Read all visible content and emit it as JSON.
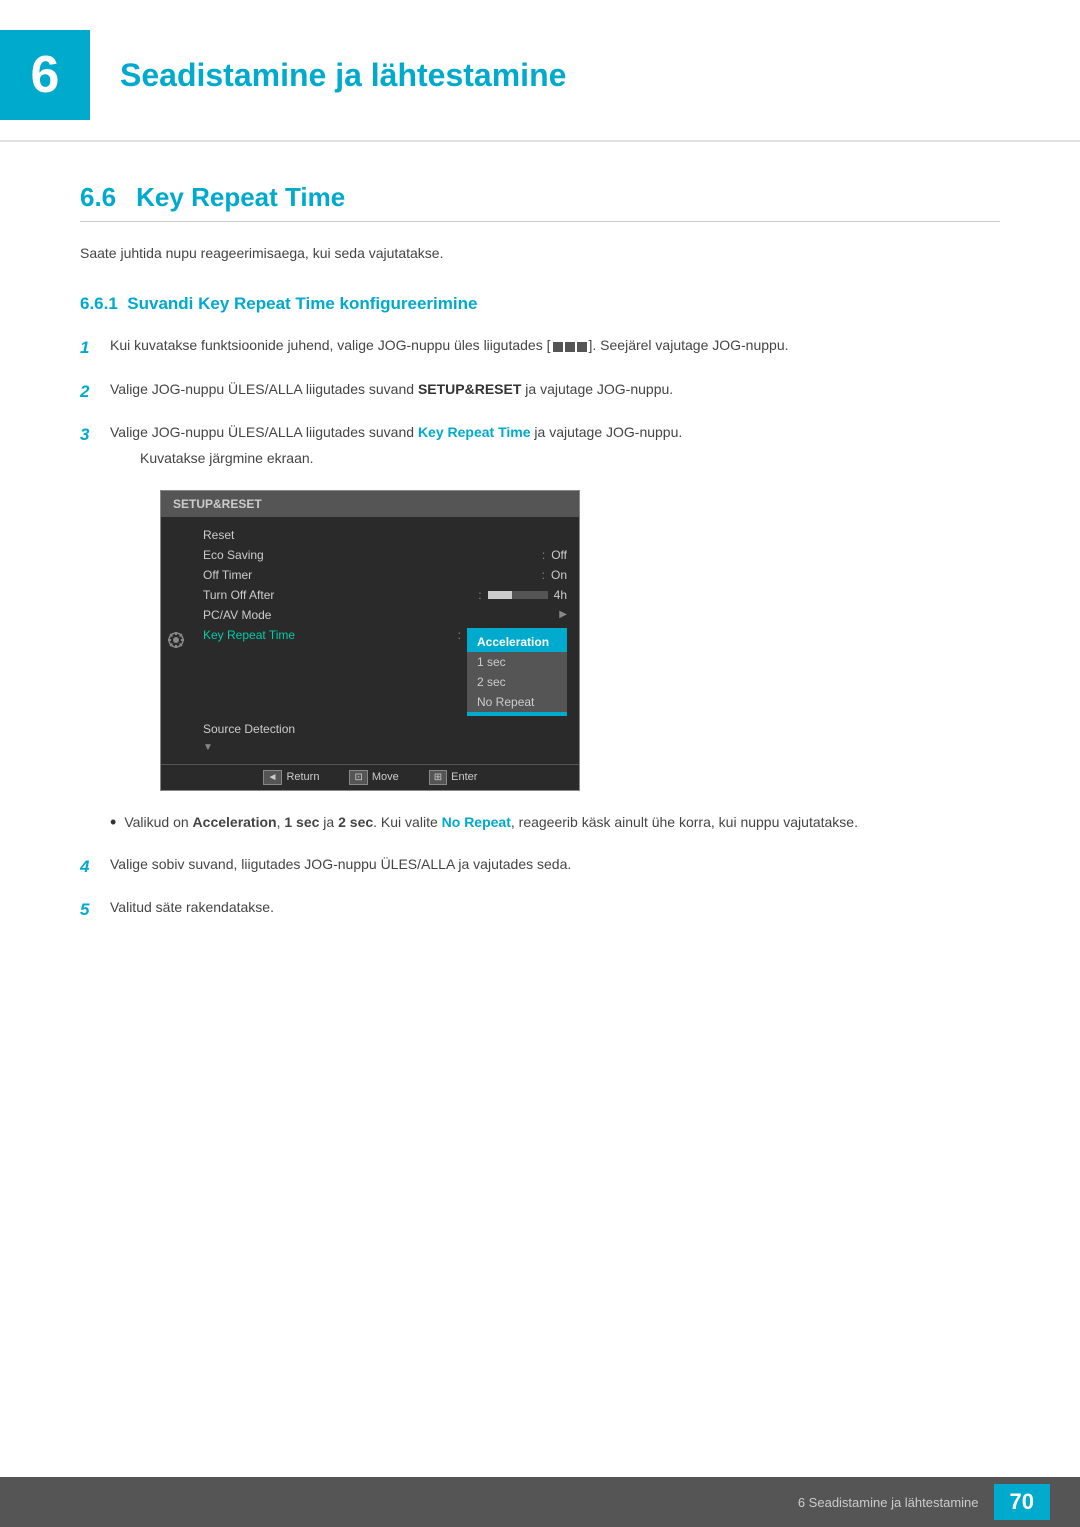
{
  "chapter": {
    "number": "6",
    "title": "Seadistamine ja lähtestamine"
  },
  "section": {
    "number": "6.6",
    "title": "Key Repeat Time",
    "intro": "Saate juhtida nupu reageerimisaega, kui seda vajutatakse."
  },
  "subsection": {
    "number": "6.6.1",
    "title": "Suvandi Key Repeat Time konfigureerimine"
  },
  "steps": [
    {
      "num": "1",
      "text1": "Kui kuvatakse funktsioonide juhend, valige JOG-nuppu üles liigutades [",
      "text2": "]. Seejärel vajutage JOG-nuppu."
    },
    {
      "num": "2",
      "text": "Valige JOG-nuppu ÜLES/ALLA liigutades suvand ",
      "bold": "SETUP&RESET",
      "text2": " ja vajutage JOG-nuppu."
    },
    {
      "num": "3",
      "text": "Valige JOG-nuppu ÜLES/ALLA liigutades suvand ",
      "bold": "Key Repeat Time",
      "text2": " ja vajutage JOG-nuppu.",
      "sub": "Kuvatakse järgmine ekraan."
    }
  ],
  "steps_456": [
    {
      "num": "4",
      "text": "Valige sobiv suvand, liigutades JOG-nuppu ÜLES/ALLA ja vajutades seda."
    },
    {
      "num": "5",
      "text": "Valitud säte rakendatakse."
    }
  ],
  "menu": {
    "header": "SETUP&RESET",
    "items": [
      {
        "label": "Reset",
        "value": ""
      },
      {
        "label": "Eco Saving",
        "sep": ":",
        "value": "Off"
      },
      {
        "label": "Off Timer",
        "sep": ":",
        "value": "On"
      },
      {
        "label": "Turn Off After",
        "sep": ":",
        "value": "4h",
        "slider": true
      },
      {
        "label": "PC/AV Mode",
        "value": ""
      },
      {
        "label": "Key Repeat Time",
        "sep": ":",
        "highlighted": true
      },
      {
        "label": "Source Detection",
        "value": ""
      }
    ],
    "dropdown": [
      {
        "label": "Acceleration",
        "active": true
      },
      {
        "label": "1 sec",
        "active": false
      },
      {
        "label": "2 sec",
        "active": false
      },
      {
        "label": "No Repeat",
        "active": false
      }
    ],
    "footer": [
      {
        "icon": "◄",
        "label": "Return"
      },
      {
        "icon": "⊡",
        "label": "Move"
      },
      {
        "icon": "⊞",
        "label": "Enter"
      }
    ]
  },
  "bullet": {
    "text1": "Valikud on ",
    "bold1": "Acceleration",
    "text2": ", ",
    "bold2": "1 sec",
    "text3": " ja ",
    "bold3": "2 sec",
    "text4": ". Kui valite ",
    "bold4": "No Repeat",
    "text5": ", reageerib käsk ainult ühe korra, kui nuppu vajutatakse."
  },
  "footer": {
    "chapter_text": "6 Seadistamine ja lähtestamine",
    "page_num": "70"
  }
}
